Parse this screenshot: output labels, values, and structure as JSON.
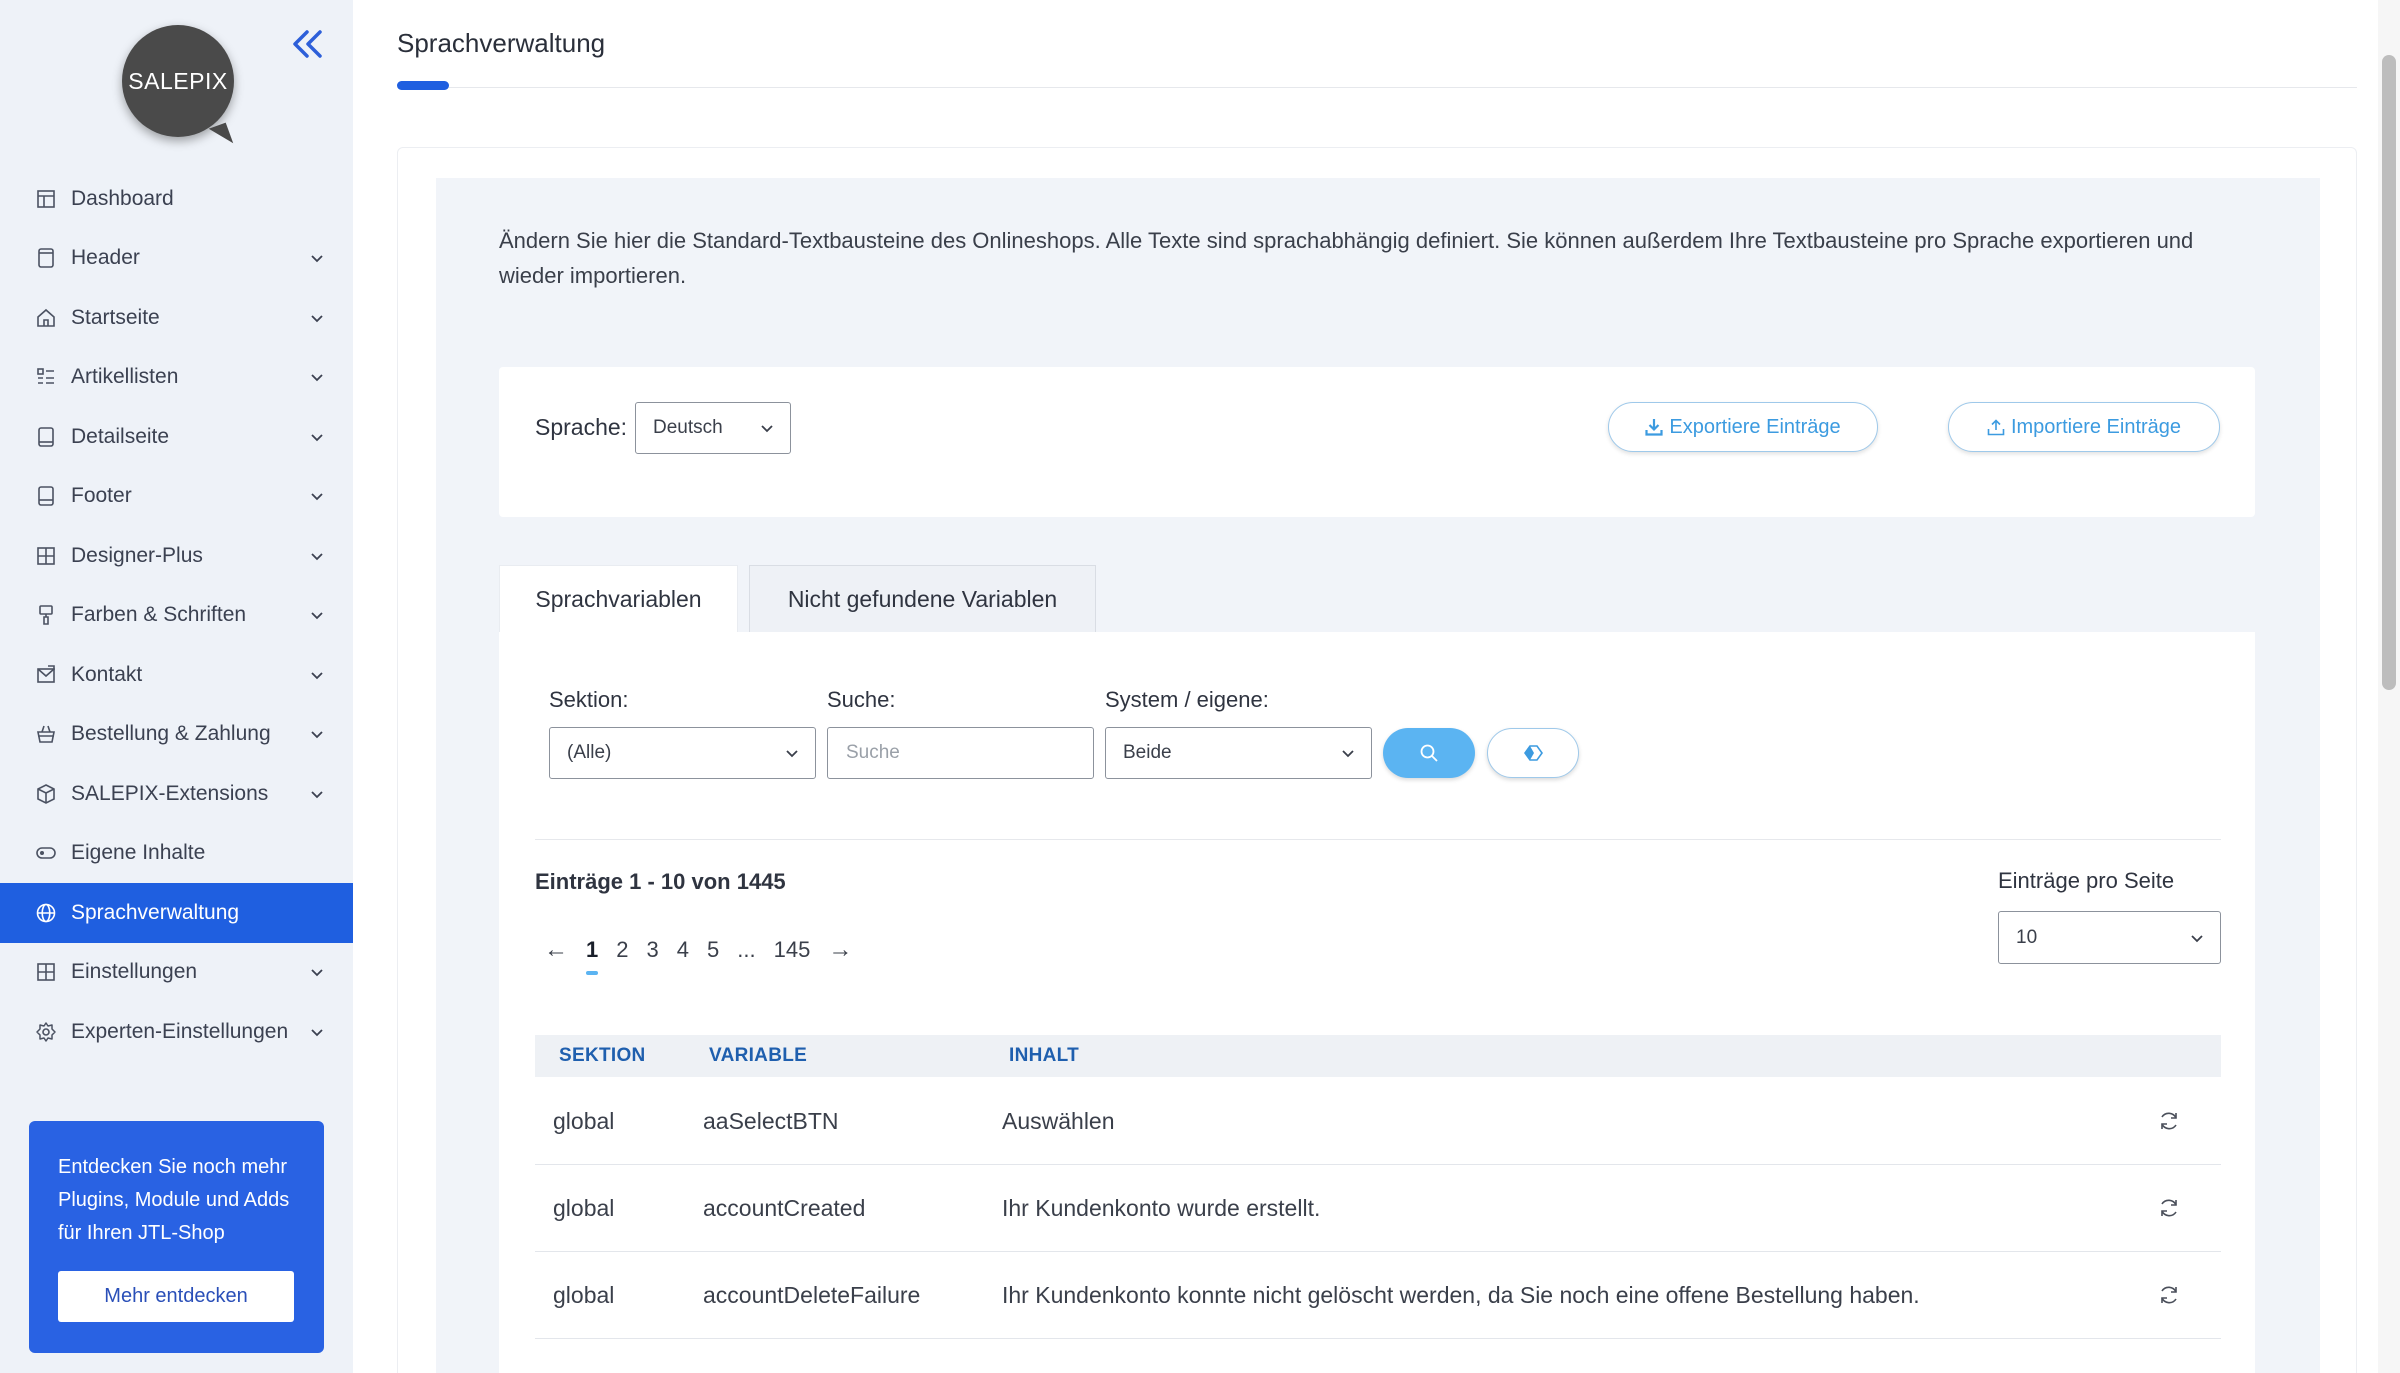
{
  "logo": {
    "text": "SALEPIX"
  },
  "sidebar": {
    "items": [
      {
        "label": "Dashboard",
        "icon": "dashboard-icon",
        "chevron": false,
        "active": false
      },
      {
        "label": "Header",
        "icon": "header-icon",
        "chevron": true,
        "active": false
      },
      {
        "label": "Startseite",
        "icon": "home-icon",
        "chevron": true,
        "active": false
      },
      {
        "label": "Artikellisten",
        "icon": "list-icon",
        "chevron": true,
        "active": false
      },
      {
        "label": "Detailseite",
        "icon": "detail-page-icon",
        "chevron": true,
        "active": false
      },
      {
        "label": "Footer",
        "icon": "footer-icon",
        "chevron": true,
        "active": false
      },
      {
        "label": "Designer-Plus",
        "icon": "designer-icon",
        "chevron": true,
        "active": false
      },
      {
        "label": "Farben & Schriften",
        "icon": "paint-icon",
        "chevron": true,
        "active": false
      },
      {
        "label": "Kontakt",
        "icon": "contact-icon",
        "chevron": true,
        "active": false
      },
      {
        "label": "Bestellung & Zahlung",
        "icon": "basket-icon",
        "chevron": true,
        "active": false
      },
      {
        "label": "SALEPIX-Extensions",
        "icon": "extensions-icon",
        "chevron": true,
        "active": false
      },
      {
        "label": "Eigene Inhalte",
        "icon": "content-icon",
        "chevron": false,
        "active": false
      },
      {
        "label": "Sprachverwaltung",
        "icon": "globe-icon",
        "chevron": false,
        "active": true
      },
      {
        "label": "Einstellungen",
        "icon": "settings-grid-icon",
        "chevron": true,
        "active": false
      },
      {
        "label": "Experten-Einstellungen",
        "icon": "gear-icon",
        "chevron": true,
        "active": false
      }
    ],
    "promo": {
      "text": "Entdecken Sie noch mehr Plugins, Module und Adds für Ihren JTL-Shop",
      "button": "Mehr entdecken"
    }
  },
  "main": {
    "title": "Sprachverwaltung",
    "intro": "Ändern Sie hier die Standard-Textbausteine des Onlineshops. Alle Texte sind sprachabhängig definiert. Sie können außerdem Ihre Textbausteine pro Sprache exportieren und wieder importieren.",
    "language": {
      "label": "Sprache:",
      "value": "Deutsch"
    },
    "export_button": "Exportiere Einträge",
    "import_button": "Importiere Einträge",
    "tabs": [
      {
        "label": "Sprachvariablen",
        "active": true
      },
      {
        "label": "Nicht gefundene Variablen",
        "active": false
      }
    ],
    "filters": {
      "section_label": "Sektion:",
      "section_value": "(Alle)",
      "search_label": "Suche:",
      "search_placeholder": "Suche",
      "system_label": "System / eigene:",
      "system_value": "Beide"
    },
    "entries_count": "Einträge 1 - 10 von 1445",
    "per_page_label": "Einträge pro Seite",
    "per_page_value": "10",
    "pagination": {
      "prev": "←",
      "pages": [
        "1",
        "2",
        "3",
        "4",
        "5",
        "...",
        "145"
      ],
      "current": "1",
      "next": "→"
    },
    "table": {
      "headers": [
        "SEKTION",
        "VARIABLE",
        "INHALT"
      ],
      "rows": [
        {
          "sektion": "global",
          "variable": "aaSelectBTN",
          "inhalt": "Auswählen"
        },
        {
          "sektion": "global",
          "variable": "accountCreated",
          "inhalt": "Ihr Kundenkonto wurde erstellt."
        },
        {
          "sektion": "global",
          "variable": "accountDeleteFailure",
          "inhalt": "Ihr Kundenkonto konnte nicht gelöscht werden, da Sie noch eine offene Bestellung haben."
        }
      ]
    }
  },
  "colors": {
    "accent": "#1f5fe0",
    "sidebar_bg": "#eef2f8",
    "button_light_blue": "#5bb4f2"
  }
}
